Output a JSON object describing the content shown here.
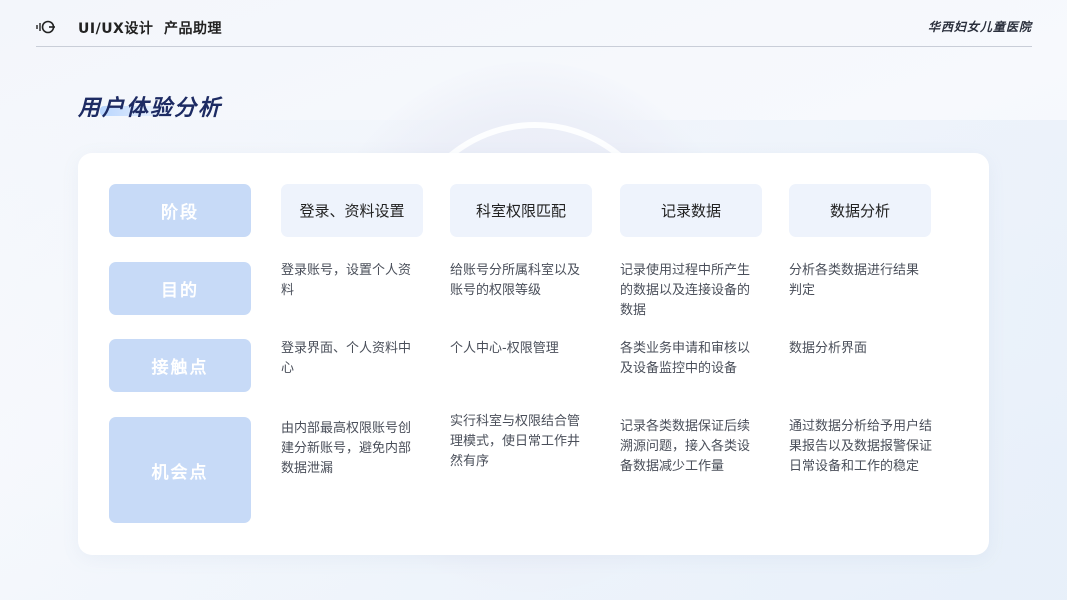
{
  "header": {
    "nav": [
      "UI/UX设计",
      "产品助理"
    ],
    "hospital": "华西妇女儿童医院"
  },
  "page_title": "用户体验分析",
  "table": {
    "row_labels": [
      "阶段",
      "目的",
      "接触点",
      "机会点"
    ],
    "stages": [
      "登录、资料设置",
      "科室权限匹配",
      "记录数据",
      "数据分析"
    ],
    "goals": [
      "登录账号，设置个人资料",
      "给账号分所属科室以及账号的权限等级",
      "记录使用过程中所产生的数据以及连接设备的数据",
      "分析各类数据进行结果判定"
    ],
    "touchpoints": [
      "登录界面、个人资料中心",
      "个人中心-权限管理",
      "各类业务申请和审核以及设备监控中的设备",
      "数据分析界面"
    ],
    "opportunities": [
      "由内部最高权限账号创建分新账号，避免内部数据泄漏",
      "实行科室与权限结合管理模式，使日常工作井然有序",
      "记录各类数据保证后续溯源问题，接入各类设备数据减少工作量",
      "通过数据分析给予用户结果报告以及数据报警保证日常设备和工作的稳定"
    ]
  },
  "colors": {
    "label_bg": "#c7daf7",
    "stage_bg": "#eef3fc",
    "title": "#1d2b63"
  }
}
